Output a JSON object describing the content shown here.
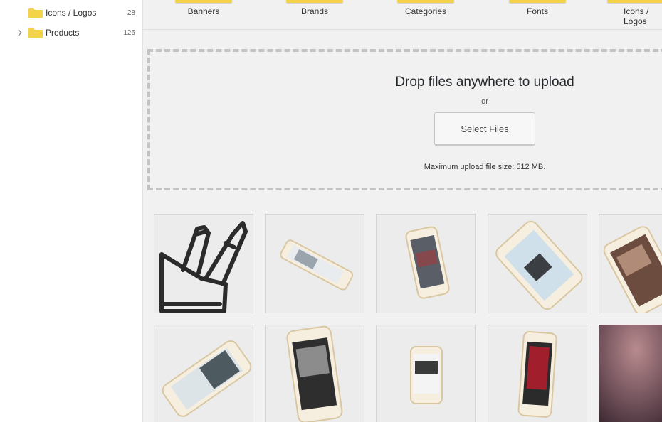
{
  "sidebar": {
    "items": [
      {
        "label": "Icons / Logos",
        "count": "28",
        "expandable": false,
        "icon": "folder-icon"
      },
      {
        "label": "Products",
        "count": "126",
        "expandable": true,
        "icon": "folder-icon"
      }
    ]
  },
  "categories": [
    {
      "label": "Banners"
    },
    {
      "label": "Brands"
    },
    {
      "label": "Categories"
    },
    {
      "label": "Fonts"
    },
    {
      "label": "Icons / Logos"
    }
  ],
  "upload": {
    "title": "Drop files anywhere to upload",
    "or": "or",
    "button": "Select Files",
    "max_size": "Maximum upload file size: 512 MB."
  },
  "media": [
    {
      "icon": "knife-block-icon"
    },
    {
      "icon": "phone-mockup-icon"
    },
    {
      "icon": "phone-mockup-icon"
    },
    {
      "icon": "phone-mockup-icon"
    },
    {
      "icon": "phone-mockup-icon"
    },
    {
      "icon": "phone-mockup-icon"
    },
    {
      "icon": "phone-mockup-icon"
    },
    {
      "icon": "phone-mockup-icon"
    },
    {
      "icon": "phone-mockup-icon"
    },
    {
      "icon": "abstract-photo"
    }
  ],
  "colors": {
    "folder": "#f3d34a",
    "accent_bar": "#f3d34a",
    "text": "#23282d"
  }
}
